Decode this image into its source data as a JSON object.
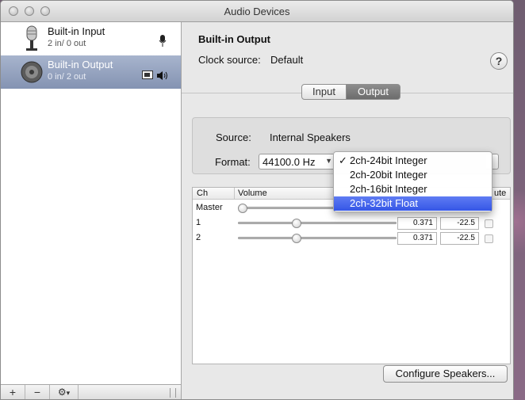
{
  "window": {
    "title": "Audio Devices"
  },
  "sidebar": {
    "devices": [
      {
        "name": "Built-in Input",
        "detail": "2 in/ 0 out",
        "icon": "microphone-icon",
        "selected": false
      },
      {
        "name": "Built-in Output",
        "detail": "0 in/ 2 out",
        "icon": "speaker-icon",
        "selected": true
      }
    ],
    "footer": {
      "add": "+",
      "remove": "−",
      "gear": "⚙",
      "gear_arrow": "▾"
    }
  },
  "main": {
    "device_title": "Built-in Output",
    "clock_source_label": "Clock source:",
    "clock_source_value": "Default",
    "help": "?",
    "tabs": [
      {
        "label": "Input",
        "active": false
      },
      {
        "label": "Output",
        "active": true
      }
    ],
    "source_label": "Source:",
    "source_value": "Internal Speakers",
    "format_label": "Format:",
    "format_value": "44100.0 Hz",
    "table": {
      "headers": {
        "ch": "Ch",
        "volume": "Volume",
        "mute": "ute"
      },
      "rows": [
        {
          "ch": "Master",
          "level": 0.0,
          "value": "",
          "db": ""
        },
        {
          "ch": "1",
          "level": 0.371,
          "value": "0.371",
          "db": "-22.5"
        },
        {
          "ch": "2",
          "level": 0.371,
          "value": "0.371",
          "db": "-22.5"
        }
      ]
    },
    "configure_button": "Configure Speakers..."
  },
  "format_menu": {
    "items": [
      {
        "label": "2ch-24bit Integer",
        "checked": true,
        "highlighted": false
      },
      {
        "label": "2ch-20bit Integer",
        "checked": false,
        "highlighted": false
      },
      {
        "label": "2ch-16bit Integer",
        "checked": false,
        "highlighted": false
      },
      {
        "label": "2ch-32bit Float",
        "checked": false,
        "highlighted": true
      }
    ],
    "checkmark": "✓"
  },
  "colors": {
    "selection": "#8493b2",
    "menu_highlight": "#3556e6"
  }
}
